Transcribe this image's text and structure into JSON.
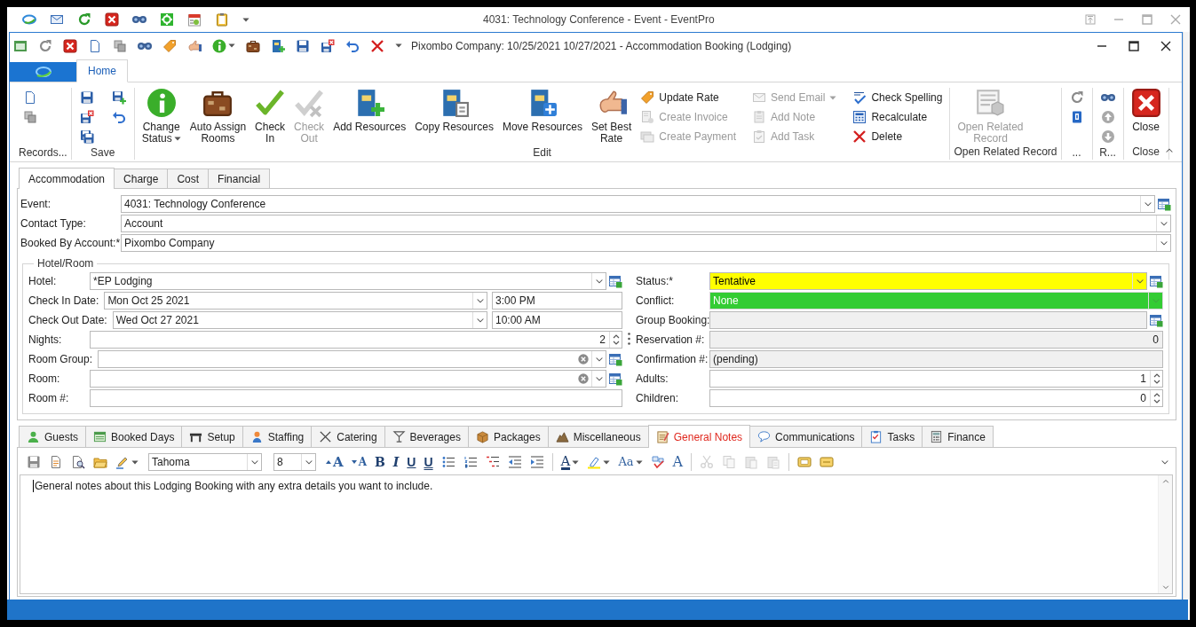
{
  "window": {
    "title": "4031: Technology Conference - Event - EventPro"
  },
  "document": {
    "title": "Pixombo Company:  10/25/2021 10/27/2021  - Accommodation Booking (Lodging)"
  },
  "ribbon": {
    "tabs": [
      {
        "label": "Home",
        "selected": true
      }
    ],
    "groups": [
      {
        "label": "Records...",
        "items": [
          {
            "kind": "icon",
            "disabled": false
          },
          {
            "kind": "icon",
            "disabled": false
          }
        ]
      },
      {
        "label": "Save",
        "items": [
          {
            "kind": "icon",
            "disabled": false
          },
          {
            "kind": "icon",
            "disabled": false
          },
          {
            "kind": "icon",
            "disabled": false
          },
          {
            "kind": "icon",
            "disabled": false
          },
          {
            "kind": "icon",
            "disabled": false
          }
        ]
      },
      {
        "label": "Edit",
        "items": [
          {
            "kind": "large",
            "label": "Change\nStatus",
            "disabled": false,
            "dropdown": true
          },
          {
            "kind": "large",
            "label": "Auto Assign\nRooms",
            "disabled": false
          },
          {
            "kind": "large",
            "label": "Check\nIn",
            "disabled": false
          },
          {
            "kind": "large",
            "label": "Check\nOut",
            "disabled": true
          },
          {
            "kind": "large",
            "label": "Add Resources",
            "disabled": false
          },
          {
            "kind": "large",
            "label": "Copy Resources",
            "disabled": false
          },
          {
            "kind": "large",
            "label": "Move Resources",
            "disabled": false
          },
          {
            "kind": "large",
            "label": "Set Best\nRate",
            "disabled": false
          },
          {
            "kind": "small",
            "label": "Update Rate",
            "disabled": false
          },
          {
            "kind": "small",
            "label": "Create Invoice",
            "disabled": true
          },
          {
            "kind": "small",
            "label": "Create Payment",
            "disabled": true
          },
          {
            "kind": "small",
            "label": "Send Email",
            "disabled": true,
            "dropdown": true
          },
          {
            "kind": "small",
            "label": "Add Note",
            "disabled": true
          },
          {
            "kind": "small",
            "label": "Add Task",
            "disabled": true
          },
          {
            "kind": "small",
            "label": "Check Spelling",
            "disabled": false
          },
          {
            "kind": "small",
            "label": "Recalculate",
            "disabled": false
          },
          {
            "kind": "small",
            "label": "Delete",
            "disabled": false
          }
        ]
      },
      {
        "label": "Open Related Record",
        "items": [
          {
            "kind": "large",
            "label": "Open Related\nRecord",
            "disabled": true
          }
        ]
      },
      {
        "label": "...",
        "items": [
          {
            "kind": "icon",
            "disabled": false
          },
          {
            "kind": "icon",
            "disabled": false
          }
        ]
      },
      {
        "label": "R...",
        "items": [
          {
            "kind": "icon",
            "disabled": false
          },
          {
            "kind": "icon",
            "disabled": false
          },
          {
            "kind": "icon",
            "disabled": false
          }
        ]
      },
      {
        "label": "Close",
        "items": [
          {
            "kind": "large",
            "label": "Close",
            "disabled": false
          }
        ]
      }
    ]
  },
  "form": {
    "tabs": [
      {
        "label": "Accommodation",
        "selected": true
      },
      {
        "label": "Charge",
        "selected": false
      },
      {
        "label": "Cost",
        "selected": false
      },
      {
        "label": "Financial",
        "selected": false
      }
    ],
    "fields": [
      {
        "label": "Event:",
        "value": "4031: Technology Conference",
        "kind": "combo",
        "lookup": true,
        "readonly": false,
        "disabled": false
      },
      {
        "label": "Contact Type:",
        "value": "Account",
        "kind": "combo",
        "readonly": false,
        "disabled": false
      },
      {
        "label": "Booked By Account:*",
        "value": "Pixombo Company",
        "kind": "combo",
        "readonly": false,
        "disabled": false
      }
    ],
    "group": {
      "title": "Hotel/Room",
      "left": [
        {
          "label": "Hotel:",
          "value": "*EP Lodging",
          "kind": "combo",
          "lookup": true,
          "readonly": false,
          "disabled": false
        },
        {
          "label": "Check In Date:",
          "value": "Mon Oct 25 2021",
          "time": "3:00 PM",
          "kind": "datetime",
          "readonly": false,
          "disabled": false
        },
        {
          "label": "Check Out Date:",
          "value": "Wed Oct 27 2021",
          "time": "10:00 AM",
          "kind": "datetime",
          "readonly": false,
          "disabled": false
        },
        {
          "label": "Nights:",
          "value": "2",
          "kind": "spin",
          "readonly": false,
          "disabled": false
        },
        {
          "label": "Room Group:",
          "kind": "combo",
          "lookup": true,
          "clear": true,
          "readonly": false,
          "disabled": false
        },
        {
          "label": "Room:",
          "kind": "combo",
          "lookup": true,
          "clear": true,
          "readonly": false,
          "disabled": false
        },
        {
          "label": "Room #:",
          "kind": "text",
          "readonly": false,
          "disabled": false
        }
      ],
      "right": [
        {
          "label": "Status:*",
          "value": "Tentative",
          "kind": "combo",
          "lookup": true,
          "readonly": false,
          "disabled": false,
          "color": "#ffff00"
        },
        {
          "label": "Conflict:",
          "value": "None",
          "kind": "combo",
          "readonly": false,
          "disabled": true,
          "color": "#33cc33"
        },
        {
          "label": "Group Booking:",
          "kind": "text",
          "lookup": true,
          "readonly": true,
          "disabled": false
        },
        {
          "label": "Reservation #:",
          "value": "0",
          "kind": "number",
          "readonly": true,
          "disabled": false
        },
        {
          "label": "Confirmation #:",
          "value": "(pending)",
          "kind": "text",
          "readonly": true,
          "disabled": false
        },
        {
          "label": "Adults:",
          "value": "1",
          "kind": "spin",
          "readonly": false,
          "disabled": false
        },
        {
          "label": "Children:",
          "value": "0",
          "kind": "spin",
          "readonly": false,
          "disabled": false
        }
      ]
    }
  },
  "detail_tabs": [
    {
      "label": "Guests",
      "selected": false
    },
    {
      "label": "Booked Days",
      "selected": false
    },
    {
      "label": "Setup",
      "selected": false
    },
    {
      "label": "Staffing",
      "selected": false
    },
    {
      "label": "Catering",
      "selected": false
    },
    {
      "label": "Beverages",
      "selected": false
    },
    {
      "label": "Packages",
      "selected": false
    },
    {
      "label": "Miscellaneous",
      "selected": false
    },
    {
      "label": "General Notes",
      "selected": true
    },
    {
      "label": "Communications",
      "selected": false
    },
    {
      "label": "Tasks",
      "selected": false
    },
    {
      "label": "Finance",
      "selected": false
    }
  ],
  "editor": {
    "toolbar": [
      {
        "kind": "icon",
        "disabled": false
      },
      {
        "kind": "icon",
        "disabled": false
      },
      {
        "kind": "icon",
        "disabled": false
      },
      {
        "kind": "icon",
        "disabled": false
      },
      {
        "kind": "icon",
        "disabled": false,
        "dropdown": true
      },
      {
        "kind": "combo",
        "value": "Tahoma"
      },
      {
        "kind": "combo",
        "value": "8"
      },
      {
        "kind": "glyph",
        "text": "A",
        "disabled": false
      },
      {
        "kind": "glyph",
        "text": "A",
        "disabled": false
      },
      {
        "kind": "glyph",
        "text": "B",
        "disabled": false
      },
      {
        "kind": "glyph",
        "text": "I",
        "disabled": false
      },
      {
        "kind": "glyph",
        "text": "U",
        "disabled": false
      },
      {
        "kind": "glyph",
        "text": "U",
        "disabled": false
      },
      {
        "kind": "icon",
        "disabled": false
      },
      {
        "kind": "icon",
        "disabled": false
      },
      {
        "kind": "icon",
        "disabled": false
      },
      {
        "kind": "icon",
        "disabled": false
      },
      {
        "kind": "icon",
        "disabled": false
      },
      {
        "kind": "separator"
      },
      {
        "kind": "glyph",
        "text": "A",
        "disabled": false,
        "dropdown": true
      },
      {
        "kind": "icon",
        "disabled": false,
        "dropdown": true
      },
      {
        "kind": "glyph",
        "text": "Aa",
        "disabled": false,
        "dropdown": true
      },
      {
        "kind": "icon",
        "disabled": false
      },
      {
        "kind": "glyph",
        "text": "A",
        "disabled": false
      },
      {
        "kind": "separator"
      },
      {
        "kind": "icon",
        "disabled": true
      },
      {
        "kind": "icon",
        "disabled": true
      },
      {
        "kind": "icon",
        "disabled": true
      },
      {
        "kind": "icon",
        "disabled": true
      },
      {
        "kind": "separator"
      },
      {
        "kind": "icon",
        "disabled": false
      },
      {
        "kind": "icon",
        "disabled": false
      }
    ],
    "text": "General notes about this Lodging Booking with any extra details you want to include."
  }
}
